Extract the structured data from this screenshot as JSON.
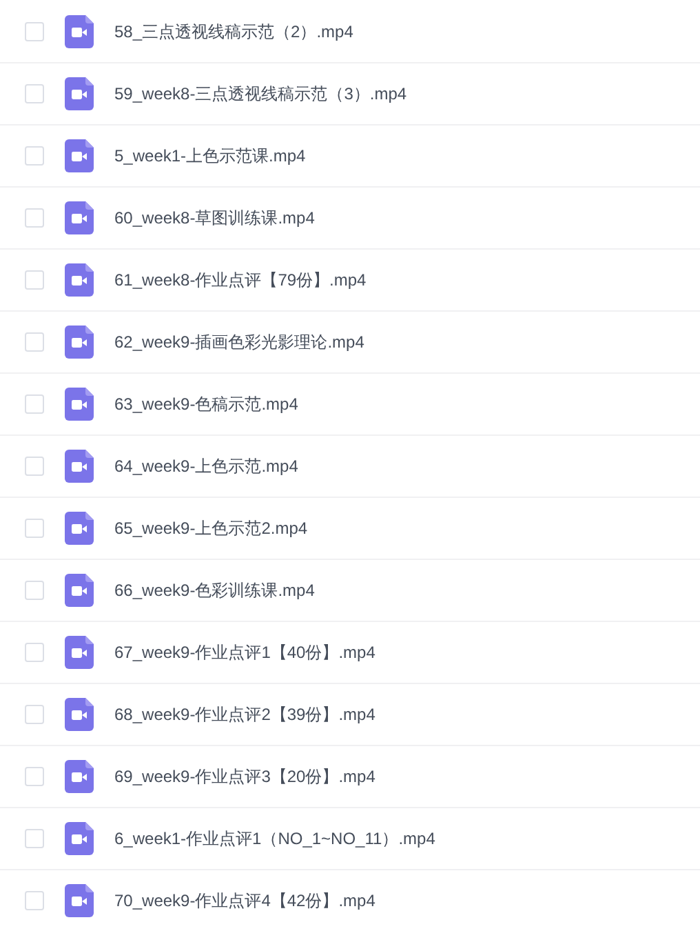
{
  "files": [
    {
      "name": "58_三点透视线稿示范（2）.mp4",
      "checked": false
    },
    {
      "name": "59_week8-三点透视线稿示范（3）.mp4",
      "checked": false
    },
    {
      "name": "5_week1-上色示范课.mp4",
      "checked": false
    },
    {
      "name": "60_week8-草图训练课.mp4",
      "checked": false
    },
    {
      "name": "61_week8-作业点评【79份】.mp4",
      "checked": false
    },
    {
      "name": "62_week9-插画色彩光影理论.mp4",
      "checked": false
    },
    {
      "name": "63_week9-色稿示范.mp4",
      "checked": false
    },
    {
      "name": "64_week9-上色示范.mp4",
      "checked": false
    },
    {
      "name": "65_week9-上色示范2.mp4",
      "checked": false
    },
    {
      "name": "66_week9-色彩训练课.mp4",
      "checked": false
    },
    {
      "name": "67_week9-作业点评1【40份】.mp4",
      "checked": false
    },
    {
      "name": "68_week9-作业点评2【39份】.mp4",
      "checked": false
    },
    {
      "name": "69_week9-作业点评3【20份】.mp4",
      "checked": false
    },
    {
      "name": "6_week1-作业点评1（NO_1~NO_11）.mp4",
      "checked": false
    },
    {
      "name": "70_week9-作业点评4【42份】.mp4",
      "checked": false
    }
  ]
}
